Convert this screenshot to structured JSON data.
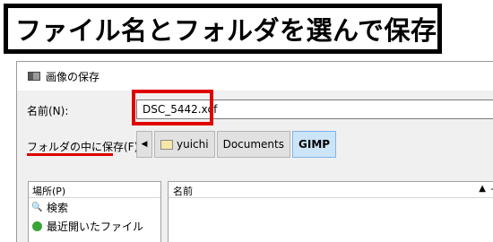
{
  "banner": {
    "text": "ファイル名とフォルダを選んで保存"
  },
  "window": {
    "title": "画像の保存"
  },
  "name_row": {
    "label": "名前(N):",
    "value": "DSC_5442.xcf"
  },
  "folder_row": {
    "label": "フォルダの中に保存(F):",
    "back_arrow": "◀",
    "crumbs": [
      "yuichi",
      "Documents",
      "GIMP"
    ],
    "active_crumb": "GIMP"
  },
  "places": {
    "header": "場所(P)",
    "items": [
      {
        "icon": "search-icon",
        "label": "検索"
      },
      {
        "icon": "recent-icon",
        "label": "最近開いたファイル"
      }
    ]
  },
  "files": {
    "column_name": "名前",
    "sort_indicator": "▲",
    "column_extra": "サ"
  },
  "colors": {
    "highlight_red": "#e00000",
    "active_crumb": "#cce4f7"
  }
}
